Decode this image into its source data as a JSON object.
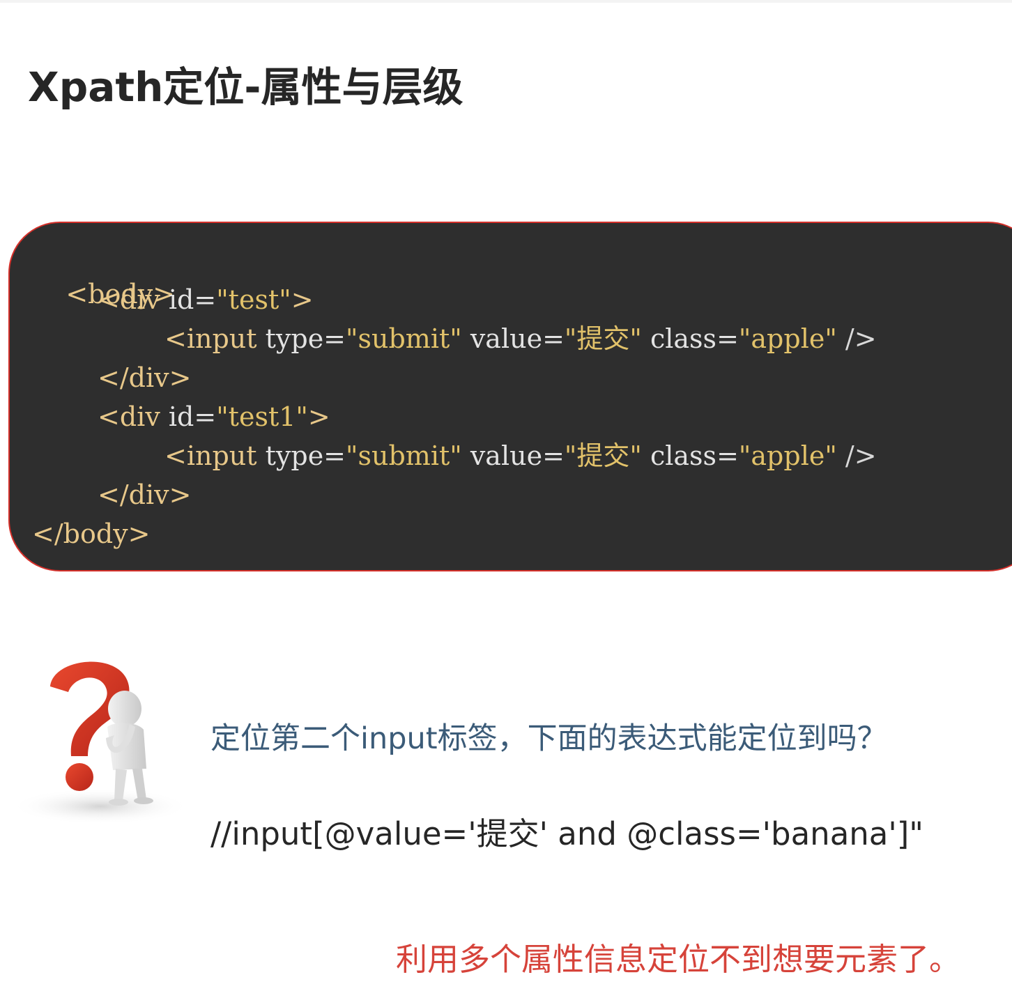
{
  "title": "Xpath定位-属性与层级",
  "code": {
    "line1": {
      "open": "<body>"
    },
    "line2": {
      "tag": "<div ",
      "attr": "id=",
      "val": "\"test\"",
      "close": ">"
    },
    "line3": {
      "tag": "<input ",
      "a1": "type=",
      "v1": "\"submit\"",
      "a2": " value=",
      "v2": "\"提交\"",
      "a3": " class=",
      "v3": "\"apple\"",
      "close": " />"
    },
    "line4": {
      "close": "</div>"
    },
    "line5": {
      "tag": "<div ",
      "attr": "id=",
      "val": "\"test1\"",
      "close": ">"
    },
    "line6": {
      "tag": "<input ",
      "a1": "type=",
      "v1": "\"submit\"",
      "a2": " value=",
      "v2": "\"提交\"",
      "a3": " class=",
      "v3": "\"apple\"",
      "close": " />"
    },
    "line7": {
      "close": "</div>"
    },
    "line8": {
      "close": "</body>"
    }
  },
  "question": "定位第二个input标签，下面的表达式能定位到吗？",
  "xpath_expression": "//input[@value='提交' and @class='banana']\"",
  "answer": "利用多个属性信息定位不到想要元素了。",
  "colors": {
    "panel_bg": "#2e2e2e",
    "panel_border": "#d6302a",
    "question_text": "#3b5b78",
    "answer_text": "#d6433a",
    "question_mark": "#d93a22"
  },
  "icons": {
    "figure": "thinking-person-question-mark-icon"
  }
}
